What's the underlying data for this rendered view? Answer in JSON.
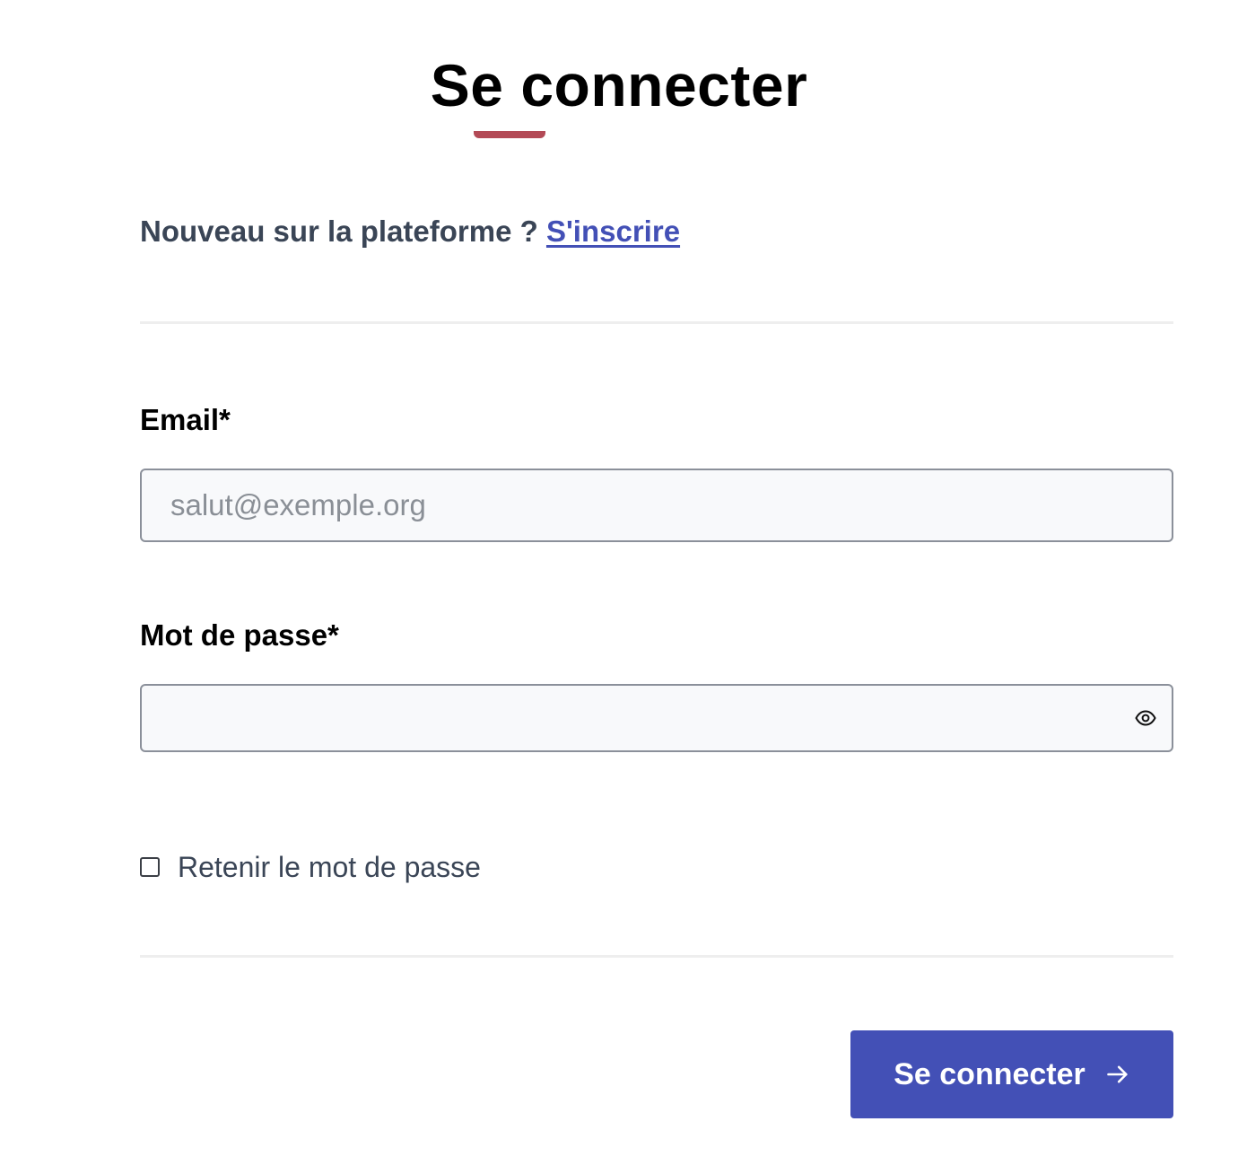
{
  "header": {
    "title": "Se connecter"
  },
  "signup": {
    "prompt": "Nouveau sur la plateforme ?",
    "link_label": "S'inscrire"
  },
  "form": {
    "email": {
      "label": "Email*",
      "placeholder": "salut@exemple.org",
      "value": ""
    },
    "password": {
      "label": "Mot de passe*",
      "value": "",
      "toggle_icon": "eye-icon"
    },
    "remember": {
      "label": "Retenir le mot de passe",
      "checked": false
    },
    "submit": {
      "label": "Se connecter",
      "icon": "arrow-right-icon"
    }
  },
  "colors": {
    "accent": "#4350b6",
    "title_underline": "#b34a56",
    "muted_text": "#3a4556",
    "input_border": "#8b909a",
    "input_background": "#f8f9fb"
  }
}
